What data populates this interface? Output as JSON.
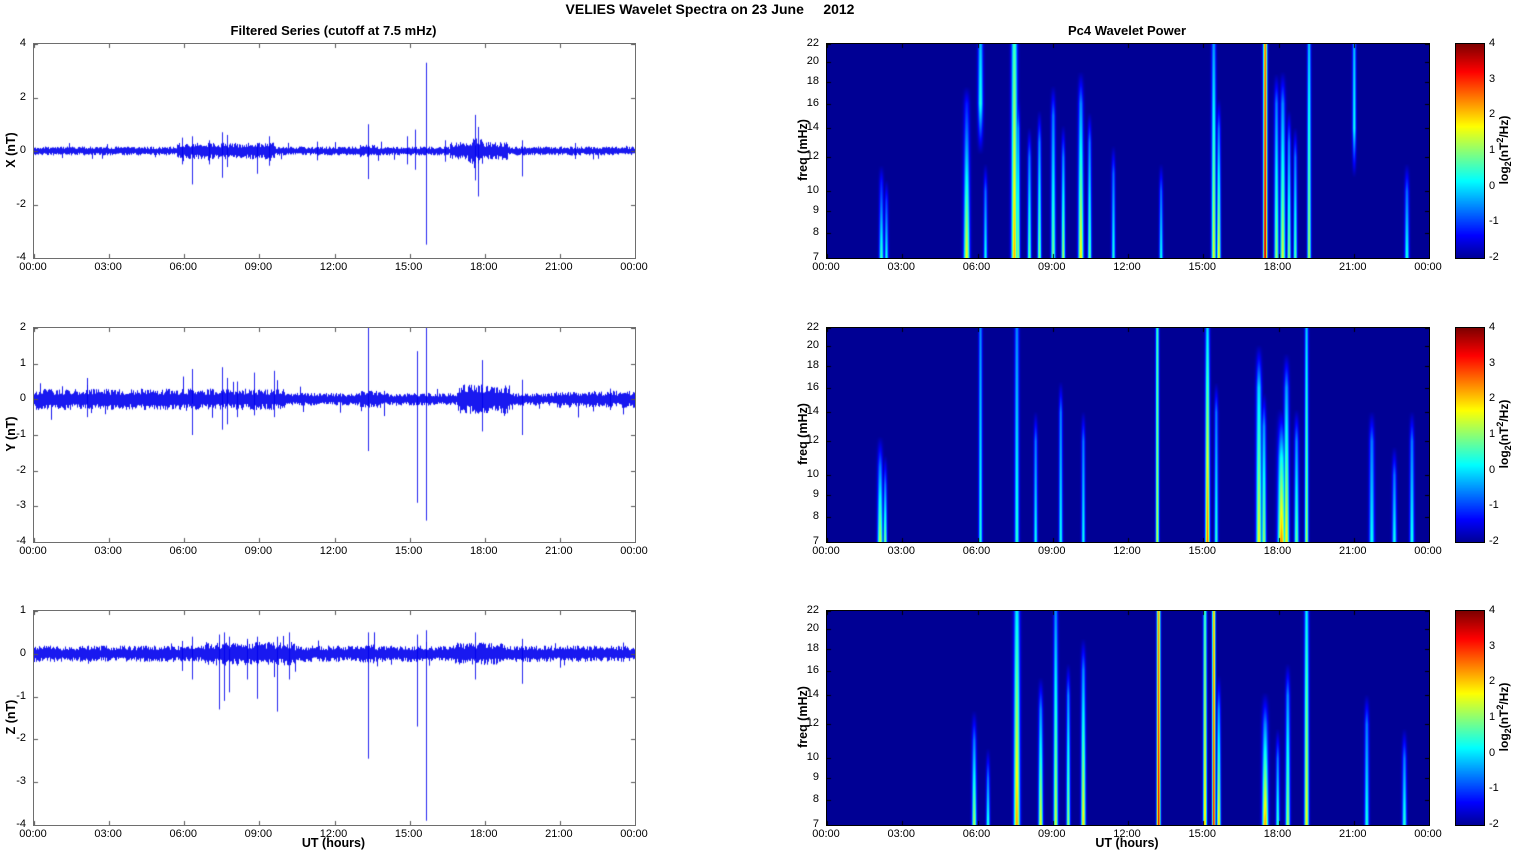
{
  "figure_title": "VELIES Wavelet Spectra on 23 June     2012",
  "left_column_title": "Filtered Series (cutoff at 7.5 mHz)",
  "right_column_title": "Pc4 Wavelet Power",
  "x_axis": {
    "label": "UT (hours)",
    "range_hours": [
      0,
      24
    ],
    "tick_hours": [
      0,
      3,
      6,
      9,
      12,
      15,
      18,
      21,
      24
    ],
    "ticks": [
      "00:00",
      "03:00",
      "06:00",
      "09:00",
      "12:00",
      "15:00",
      "18:00",
      "21:00",
      "00:00"
    ]
  },
  "colorbar": {
    "ticks": [
      4,
      3,
      2,
      1,
      0,
      -1,
      -2
    ],
    "range": [
      -2,
      4
    ],
    "label_parts": {
      "prefix": "log",
      "sub": "2",
      "mid": "(nT",
      "sup": "2",
      "suffix": "/Hz)"
    }
  },
  "colors": {
    "series": "#0000ee",
    "spectrogram_base": "#00008f",
    "background": "#ffffff",
    "axis_ts": "#555555",
    "axis_sp": "#000000"
  },
  "spike_format": "[t_hours, min_nT, max_nT]",
  "streak_format": "[t_hours, f_low_mHz, f_high_mHz, peak_log2_power, fade_toward_top, sigma_hours]",
  "chart_data": [
    {
      "id": "series-x",
      "type": "line",
      "ylabel": "X (nT)",
      "ylim": [
        -4,
        4
      ],
      "yticks": [
        4,
        2,
        0,
        -2,
        -4
      ],
      "seed": 11,
      "noise_base": 0.14,
      "noise_bursts": [
        [
          5.7,
          9.6,
          0.26
        ],
        [
          13.0,
          13.6,
          0.2
        ],
        [
          16.6,
          18.9,
          0.28
        ],
        [
          17.3,
          17.9,
          0.4
        ]
      ],
      "spikes": [
        [
          5.9,
          -0.5,
          0.5
        ],
        [
          6.3,
          -1.25,
          0.55
        ],
        [
          7.0,
          -0.5,
          0.4
        ],
        [
          7.5,
          -1.0,
          0.7
        ],
        [
          7.7,
          -0.6,
          0.6
        ],
        [
          8.9,
          -0.85,
          0.3
        ],
        [
          9.4,
          -0.55,
          0.55
        ],
        [
          11.3,
          -0.35,
          0.35
        ],
        [
          13.35,
          -1.05,
          1.0
        ],
        [
          14.9,
          -0.5,
          0.55
        ],
        [
          15.2,
          -0.7,
          0.8
        ],
        [
          15.65,
          -3.5,
          3.3
        ],
        [
          16.4,
          -0.4,
          0.4
        ],
        [
          17.6,
          -1.1,
          1.35
        ],
        [
          17.75,
          -1.7,
          0.9
        ],
        [
          19.5,
          -0.95,
          0.4
        ],
        [
          21.6,
          -0.3,
          0.3
        ]
      ]
    },
    {
      "id": "series-y",
      "type": "line",
      "ylabel": "Y (nT)",
      "ylim": [
        -4,
        2
      ],
      "yticks": [
        2,
        1,
        0,
        -1,
        -2,
        -3,
        -4
      ],
      "seed": 23,
      "noise_base": 0.15,
      "noise_bursts": [
        [
          0,
          10.0,
          0.25
        ],
        [
          13.0,
          14.0,
          0.2
        ],
        [
          16.9,
          19.0,
          0.35
        ],
        [
          20.8,
          24,
          0.2
        ]
      ],
      "spikes": [
        [
          2.1,
          -0.5,
          0.4
        ],
        [
          6.3,
          -1.0,
          0.85
        ],
        [
          7.5,
          -0.85,
          0.9
        ],
        [
          7.7,
          -0.7,
          0.6
        ],
        [
          8.1,
          -0.5,
          0.5
        ],
        [
          8.8,
          -0.45,
          0.75
        ],
        [
          9.6,
          -0.5,
          0.8
        ],
        [
          13.35,
          -1.45,
          2.0
        ],
        [
          15.3,
          -2.9,
          1.35
        ],
        [
          15.65,
          -3.4,
          2.0
        ],
        [
          17.9,
          -0.9,
          1.1
        ],
        [
          19.5,
          -1.0,
          0.55
        ],
        [
          23.0,
          -0.3,
          0.3
        ]
      ]
    },
    {
      "id": "series-z",
      "type": "line",
      "ylabel": "Z (nT)",
      "ylim": [
        -4,
        1
      ],
      "yticks": [
        1,
        0,
        -1,
        -2,
        -3,
        -4
      ],
      "seed": 37,
      "noise_base": 0.16,
      "noise_bursts": [
        [
          6.8,
          10.4,
          0.23
        ],
        [
          13.0,
          13.6,
          0.19
        ],
        [
          16.8,
          18.8,
          0.22
        ]
      ],
      "spikes": [
        [
          5.9,
          -0.4,
          0.3
        ],
        [
          6.3,
          -0.6,
          0.4
        ],
        [
          7.4,
          -1.3,
          0.45
        ],
        [
          7.6,
          -1.1,
          0.5
        ],
        [
          7.8,
          -0.9,
          0.4
        ],
        [
          8.5,
          -0.6,
          0.35
        ],
        [
          8.9,
          -1.05,
          0.4
        ],
        [
          9.7,
          -1.35,
          0.4
        ],
        [
          10.2,
          -0.6,
          0.5
        ],
        [
          13.35,
          -2.45,
          0.5
        ],
        [
          15.3,
          -1.7,
          0.45
        ],
        [
          15.65,
          -3.9,
          0.55
        ],
        [
          17.6,
          -0.6,
          0.5
        ],
        [
          19.5,
          -0.7,
          0.35
        ]
      ]
    },
    {
      "id": "wavelet-x",
      "type": "heatmap",
      "ylabel": "freq (mHz)",
      "yticks": [
        22,
        20,
        18,
        16,
        14,
        12,
        10,
        9,
        8,
        7
      ],
      "freq_range": [
        7,
        22
      ],
      "value_range": [
        -2,
        4
      ],
      "background_value": -2,
      "streaks": [
        [
          2.15,
          7,
          10.5,
          0.6,
          1.8,
          0.06
        ],
        [
          2.35,
          7,
          9.5,
          0.3,
          1.3,
          0.05
        ],
        [
          5.55,
          7,
          16,
          1.7,
          2.9,
          0.08
        ],
        [
          6.1,
          16,
          22,
          0.4,
          0.6,
          0.07
        ],
        [
          6.3,
          7,
          10,
          0.3,
          1.0,
          0.05
        ],
        [
          7.45,
          7,
          22,
          2.2,
          1.6,
          0.08
        ],
        [
          7.6,
          7,
          14,
          1.2,
          1.6,
          0.05
        ],
        [
          8.05,
          7,
          12,
          0.9,
          1.5,
          0.05
        ],
        [
          8.45,
          7,
          13,
          1.1,
          1.6,
          0.05
        ],
        [
          9.0,
          7,
          15,
          1.0,
          1.6,
          0.06
        ],
        [
          9.4,
          7,
          12,
          1.3,
          1.8,
          0.05
        ],
        [
          10.1,
          7,
          16,
          1.9,
          2.4,
          0.07
        ],
        [
          10.45,
          7,
          13,
          1.0,
          1.6,
          0.05
        ],
        [
          11.4,
          7,
          11,
          0.4,
          1.1,
          0.05
        ],
        [
          13.3,
          7,
          10,
          0.3,
          1.0,
          0.05
        ],
        [
          15.4,
          7,
          22,
          1.6,
          2.0,
          0.06
        ],
        [
          15.6,
          7,
          14,
          1.8,
          2.4,
          0.05
        ],
        [
          17.45,
          7,
          22,
          3.7,
          1.1,
          0.055
        ],
        [
          17.9,
          7,
          16,
          1.2,
          1.8,
          0.06
        ],
        [
          18.15,
          7,
          16,
          1.5,
          2.0,
          0.07
        ],
        [
          18.4,
          7,
          13,
          1.1,
          1.6,
          0.05
        ],
        [
          18.65,
          7,
          12,
          0.8,
          1.4,
          0.05
        ],
        [
          19.2,
          7,
          22,
          1.3,
          1.4,
          0.05
        ],
        [
          21.0,
          14,
          22,
          0.3,
          0.5,
          0.05
        ],
        [
          23.1,
          7,
          10,
          0.4,
          1.1,
          0.06
        ]
      ]
    },
    {
      "id": "wavelet-y",
      "type": "heatmap",
      "ylabel": "freq (mHz)",
      "yticks": [
        22,
        20,
        18,
        16,
        14,
        12,
        10,
        9,
        8,
        7
      ],
      "freq_range": [
        7,
        22
      ],
      "value_range": [
        -2,
        4
      ],
      "background_value": -2,
      "streaks": [
        [
          2.1,
          7,
          10.5,
          1.4,
          2.0,
          0.07
        ],
        [
          2.3,
          7,
          9.5,
          1.0,
          1.6,
          0.05
        ],
        [
          6.1,
          7,
          22,
          0.4,
          0.9,
          0.05
        ],
        [
          7.55,
          7,
          22,
          0.5,
          1.0,
          0.06
        ],
        [
          8.3,
          7,
          12,
          0.3,
          0.9,
          0.05
        ],
        [
          9.3,
          7,
          14,
          0.35,
          0.9,
          0.05
        ],
        [
          10.2,
          7,
          12,
          0.3,
          0.9,
          0.05
        ],
        [
          13.15,
          7,
          22,
          1.5,
          0.9,
          0.045
        ],
        [
          15.15,
          7,
          22,
          2.7,
          2.7,
          0.06
        ],
        [
          15.5,
          7,
          14,
          0.5,
          1.1,
          0.05
        ],
        [
          17.2,
          7,
          16,
          1.7,
          1.7,
          0.075
        ],
        [
          17.4,
          7,
          13,
          1.2,
          1.6,
          0.06
        ],
        [
          18.1,
          7,
          11,
          2.4,
          2.1,
          0.1
        ],
        [
          18.3,
          7,
          16,
          1.8,
          2.2,
          0.07
        ],
        [
          18.7,
          7,
          12,
          0.9,
          1.4,
          0.06
        ],
        [
          19.1,
          7,
          22,
          1.3,
          1.4,
          0.05
        ],
        [
          21.7,
          7,
          12,
          0.3,
          0.9,
          0.07
        ],
        [
          22.6,
          7,
          10,
          0.35,
          1.0,
          0.06
        ],
        [
          23.3,
          7,
          12,
          0.4,
          1.0,
          0.06
        ]
      ]
    },
    {
      "id": "wavelet-z",
      "type": "heatmap",
      "ylabel": "freq (mHz)",
      "yticks": [
        22,
        20,
        18,
        16,
        14,
        12,
        10,
        9,
        8,
        7
      ],
      "freq_range": [
        7,
        22
      ],
      "value_range": [
        -2,
        4
      ],
      "background_value": -2,
      "streaks": [
        [
          5.85,
          7,
          11,
          1.3,
          1.9,
          0.06
        ],
        [
          6.4,
          7,
          9,
          0.5,
          1.1,
          0.05
        ],
        [
          7.55,
          7,
          22,
          2.3,
          2.2,
          0.08
        ],
        [
          8.5,
          7,
          13,
          1.7,
          2.2,
          0.06
        ],
        [
          9.1,
          7,
          22,
          1.5,
          2.0,
          0.06
        ],
        [
          9.6,
          7,
          14,
          1.2,
          1.7,
          0.05
        ],
        [
          10.2,
          7,
          16,
          1.9,
          2.4,
          0.06
        ],
        [
          13.2,
          7,
          22,
          3.5,
          1.2,
          0.05
        ],
        [
          15.05,
          7,
          22,
          2.1,
          1.5,
          0.05
        ],
        [
          15.4,
          7,
          22,
          3.3,
          1.1,
          0.045
        ],
        [
          15.6,
          7,
          13,
          2.0,
          2.4,
          0.05
        ],
        [
          17.45,
          7,
          12,
          2.3,
          2.8,
          0.08
        ],
        [
          17.95,
          7,
          10,
          0.6,
          1.2,
          0.05
        ],
        [
          18.35,
          7,
          14,
          1.3,
          1.8,
          0.06
        ],
        [
          19.1,
          7,
          22,
          1.8,
          1.7,
          0.06
        ],
        [
          21.5,
          7,
          12,
          0.4,
          1.0,
          0.06
        ],
        [
          23.0,
          7,
          10,
          0.5,
          1.1,
          0.06
        ]
      ]
    }
  ]
}
